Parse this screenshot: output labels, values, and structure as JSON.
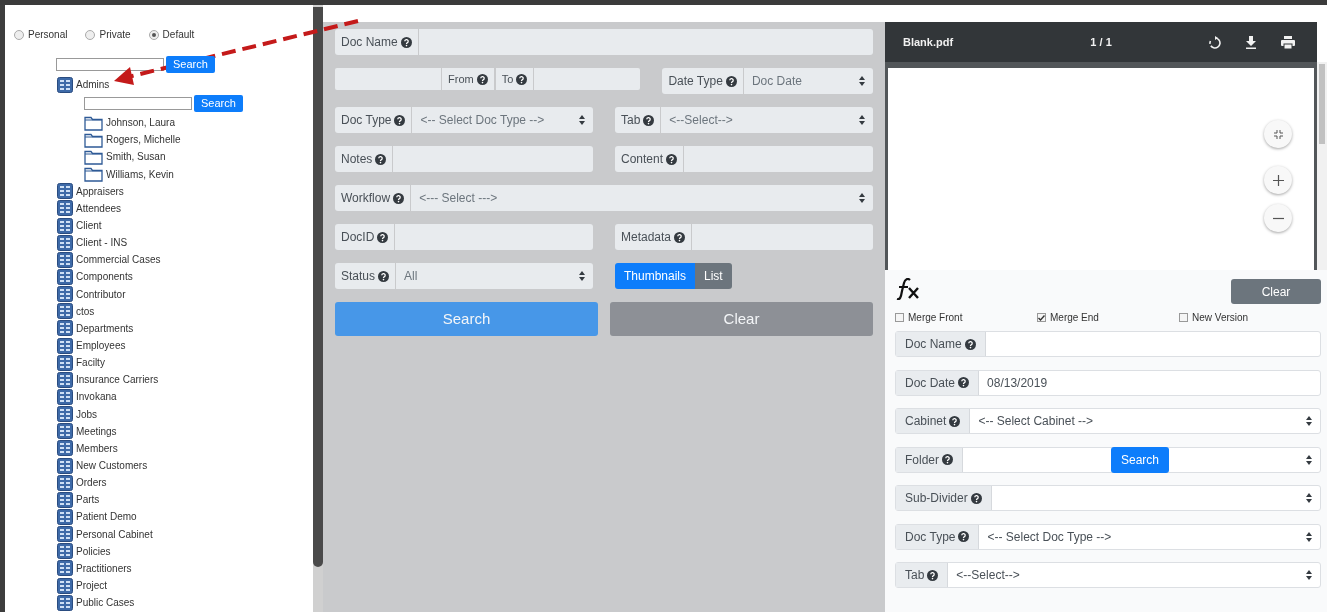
{
  "scope_options": [
    {
      "label": "Personal",
      "selected": false
    },
    {
      "label": "Private",
      "selected": false
    },
    {
      "label": "Default",
      "selected": true
    }
  ],
  "tree": {
    "search_button": "Search",
    "items": [
      {
        "label": "Admins",
        "search_button": "Search",
        "children": [
          {
            "label": "Johnson, Laura"
          },
          {
            "label": "Rogers, Michelle"
          },
          {
            "label": "Smith, Susan"
          },
          {
            "label": "Williams, Kevin"
          }
        ]
      },
      {
        "label": "Appraisers"
      },
      {
        "label": "Attendees"
      },
      {
        "label": "Client"
      },
      {
        "label": "Client - INS"
      },
      {
        "label": "Commercial Cases"
      },
      {
        "label": "Components"
      },
      {
        "label": "Contributor"
      },
      {
        "label": "ctos"
      },
      {
        "label": "Departments"
      },
      {
        "label": "Employees"
      },
      {
        "label": "Facilty"
      },
      {
        "label": "Insurance Carriers"
      },
      {
        "label": "Invokana"
      },
      {
        "label": "Jobs"
      },
      {
        "label": "Meetings"
      },
      {
        "label": "Members"
      },
      {
        "label": "New Customers"
      },
      {
        "label": "Orders"
      },
      {
        "label": "Parts"
      },
      {
        "label": "Patient Demo"
      },
      {
        "label": "Personal Cabinet"
      },
      {
        "label": "Policies"
      },
      {
        "label": "Practitioners"
      },
      {
        "label": "Project"
      },
      {
        "label": "Public Cases"
      }
    ]
  },
  "search_form": {
    "rows": [
      [
        {
          "kind": "text",
          "label": "Doc Name"
        }
      ],
      [
        {
          "kind": "range",
          "labels": [
            "From",
            "To"
          ]
        },
        {
          "kind": "select",
          "label": "Date Type",
          "value": "Doc Date"
        }
      ],
      [
        {
          "kind": "select",
          "label": "Doc Type",
          "value": "<-- Select Doc Type -->"
        },
        {
          "kind": "select",
          "label": "Tab",
          "value": "<--Select-->"
        }
      ],
      [
        {
          "kind": "text",
          "label": "Notes"
        },
        {
          "kind": "text",
          "label": "Content"
        }
      ],
      [
        {
          "kind": "select",
          "label": "Workflow",
          "value": "<--- Select --->"
        }
      ],
      [
        {
          "kind": "text",
          "label": "DocID"
        },
        {
          "kind": "text",
          "label": "Metadata"
        }
      ],
      [
        {
          "kind": "select",
          "label": "Status",
          "value": "All"
        },
        {
          "kind": "toggle",
          "options": [
            {
              "label": "Thumbnails",
              "selected": true
            },
            {
              "label": "List",
              "selected": false
            }
          ]
        }
      ]
    ],
    "buttons": [
      {
        "label": "Search",
        "kind": "primary"
      },
      {
        "label": "Clear",
        "kind": "secondary"
      }
    ]
  },
  "viewer": {
    "file_name": "Blank.pdf",
    "page": "1 / 1"
  },
  "upload_form": {
    "clear_button": "Clear",
    "options": [
      {
        "label": "Merge Front",
        "checked": false
      },
      {
        "label": "Merge End",
        "checked": true
      },
      {
        "label": "New Version",
        "checked": false
      }
    ],
    "fields": [
      {
        "kind": "text",
        "label": "Doc Name"
      },
      {
        "kind": "text",
        "label": "Doc Date",
        "value": "08/13/2019"
      },
      {
        "kind": "select",
        "label": "Cabinet",
        "value": "<-- Select Cabinet -->"
      },
      {
        "kind": "folder",
        "label": "Folder",
        "button": "Search"
      },
      {
        "kind": "select",
        "label": "Sub-Divider"
      },
      {
        "kind": "select",
        "label": "Doc Type",
        "value": "<-- Select Doc Type -->"
      },
      {
        "kind": "select",
        "label": "Tab",
        "value": "<--Select-->"
      }
    ]
  }
}
